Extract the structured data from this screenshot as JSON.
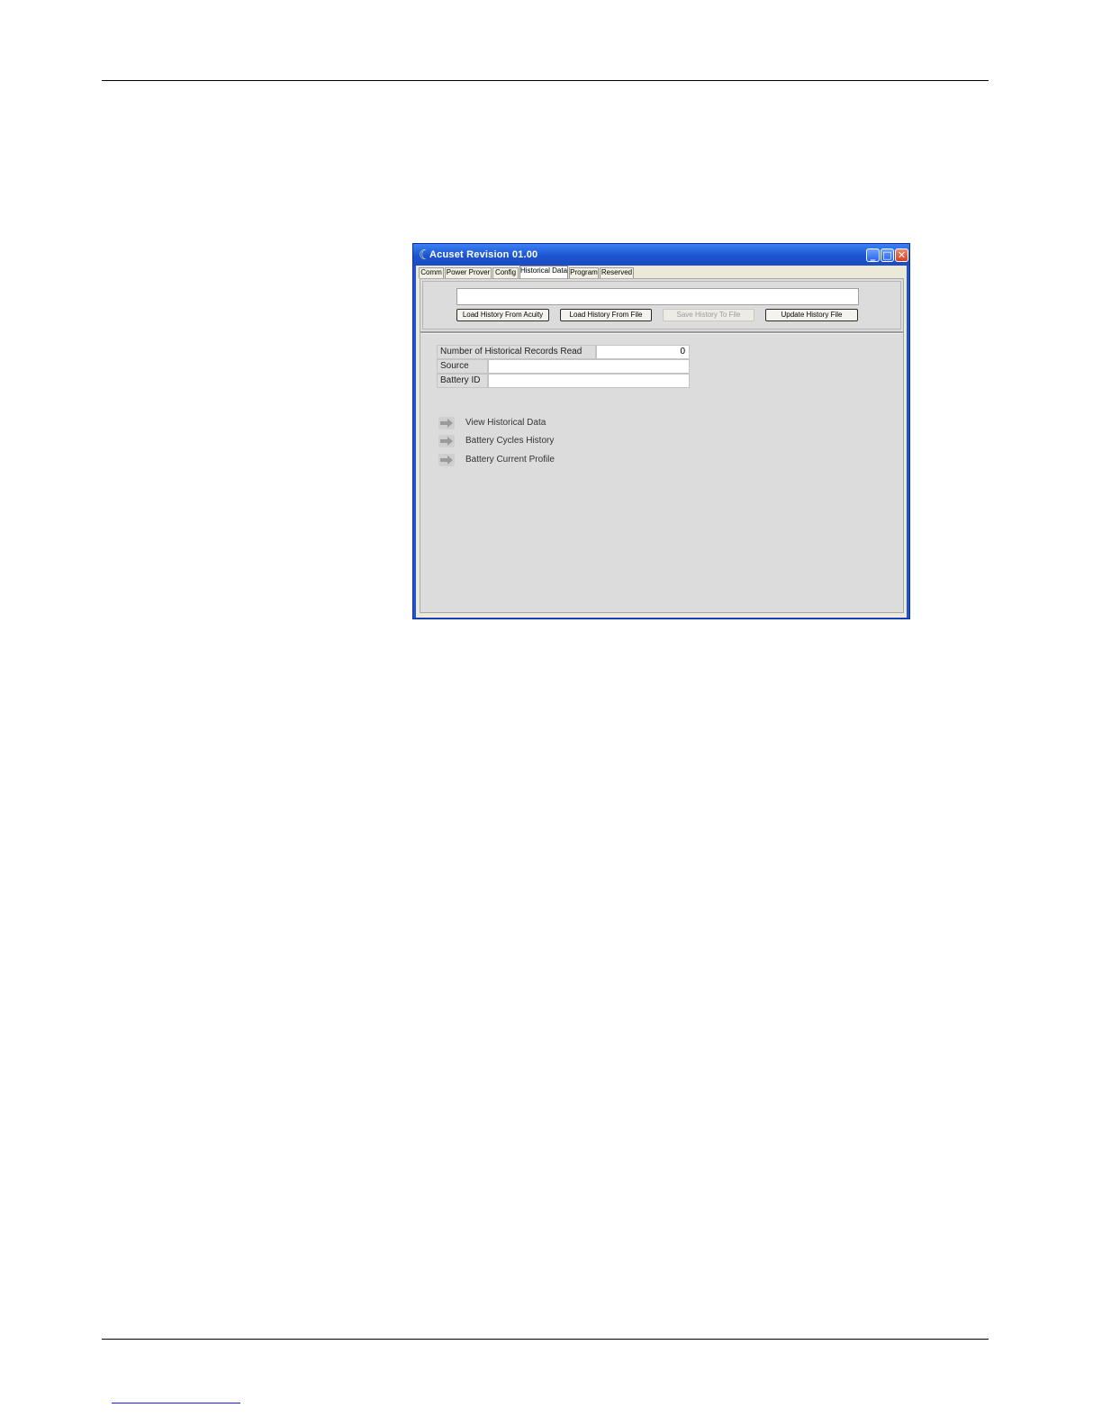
{
  "window": {
    "title": "Acuset Revision 01.00",
    "controls": {
      "minimize": "_",
      "maximize": "□",
      "close": "✕"
    }
  },
  "tabs": [
    {
      "label": "Comm"
    },
    {
      "label": "Power Prover"
    },
    {
      "label": "Config"
    },
    {
      "label": "Historical Data"
    },
    {
      "label": "Program"
    },
    {
      "label": "Reserved"
    }
  ],
  "active_tab": "Historical Data",
  "status_field": {
    "value": ""
  },
  "buttons": {
    "load_acuity": "Load History From Acuity",
    "load_file": "Load History From File",
    "save_file": "Save History To File",
    "update_file": "Update History File"
  },
  "info": {
    "records_label": "Number of Historical Records Read",
    "records_value": "0",
    "source_label": "Source",
    "source_value": "",
    "battery_label": "Battery ID",
    "battery_value": ""
  },
  "links": [
    {
      "label": "View Historical Data",
      "icon": "arrow-right-icon"
    },
    {
      "label": "Battery Cycles History",
      "icon": "arrow-right-icon"
    },
    {
      "label": "Battery Current Profile",
      "icon": "arrow-right-icon"
    }
  ],
  "colors": {
    "titlebar": "#1c54d0",
    "panel": "#dcdcdc",
    "page_rule": "#000000"
  }
}
